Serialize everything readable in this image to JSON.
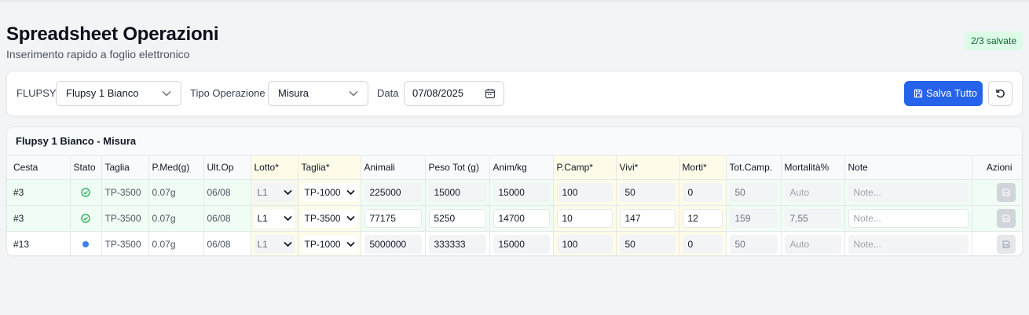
{
  "header": {
    "title": "Spreadsheet Operazioni",
    "subtitle": "Inserimento rapido a foglio elettronico",
    "saved_badge": "2/3 salvate"
  },
  "toolbar": {
    "flupsy_label": "FLUPSY",
    "flupsy_value": "Flupsy 1 Bianco",
    "tipo_label": "Tipo Operazione",
    "tipo_value": "Misura",
    "date_label": "Data",
    "date_value": "07/08/2025",
    "save_all_label": "Salva Tutto",
    "icons": {
      "save": "save-icon",
      "refresh": "refresh-icon",
      "calendar": "calendar-icon"
    }
  },
  "grid": {
    "title": "Flupsy 1 Bianco - Misura",
    "columns": [
      "Cesta",
      "Stato",
      "Taglia",
      "P.Med(g)",
      "Ult.Op",
      "Lotto*",
      "Taglia*",
      "Animali",
      "Peso Tot (g)",
      "Anim/kg",
      "P.Camp*",
      "Vivi*",
      "Morti*",
      "Tot.Camp.",
      "Mortalità%",
      "Note",
      "Azioni"
    ],
    "rows": [
      {
        "cesta": "#3",
        "stato": "saved",
        "taglia": "TP-3500",
        "pmed": "0.07g",
        "ultop": "06/08",
        "lotto": "L1",
        "taglia_sel": "TP-1000",
        "animali": "225000",
        "peso": "15000",
        "animkg": "15000",
        "pcamp": "100",
        "vivi": "50",
        "morti": "0",
        "totcamp": "50",
        "mortalita": "Auto",
        "note": "Note..."
      },
      {
        "cesta": "#3",
        "stato": "saved",
        "taglia": "TP-3500",
        "pmed": "0.07g",
        "ultop": "06/08",
        "lotto": "L1",
        "taglia_sel": "TP-3500",
        "animali": "77175",
        "peso": "5250",
        "animkg": "14700",
        "pcamp": "10",
        "vivi": "147",
        "morti": "12",
        "totcamp": "159",
        "mortalita": "7,55",
        "note": "Note..."
      },
      {
        "cesta": "#13",
        "stato": "pending",
        "taglia": "TP-3500",
        "pmed": "0.07g",
        "ultop": "06/08",
        "lotto": "L1",
        "taglia_sel": "TP-1000",
        "animali": "5000000",
        "peso": "333333",
        "animkg": "15000",
        "pcamp": "100",
        "vivi": "50",
        "morti": "0",
        "totcamp": "50",
        "mortalita": "Auto",
        "note": "Note..."
      }
    ]
  },
  "colors": {
    "accent": "#2563eb",
    "saved_row": "#f0fdf4",
    "required_col": "#fefce8",
    "ok": "#16a34a",
    "pending": "#3b82f6"
  }
}
